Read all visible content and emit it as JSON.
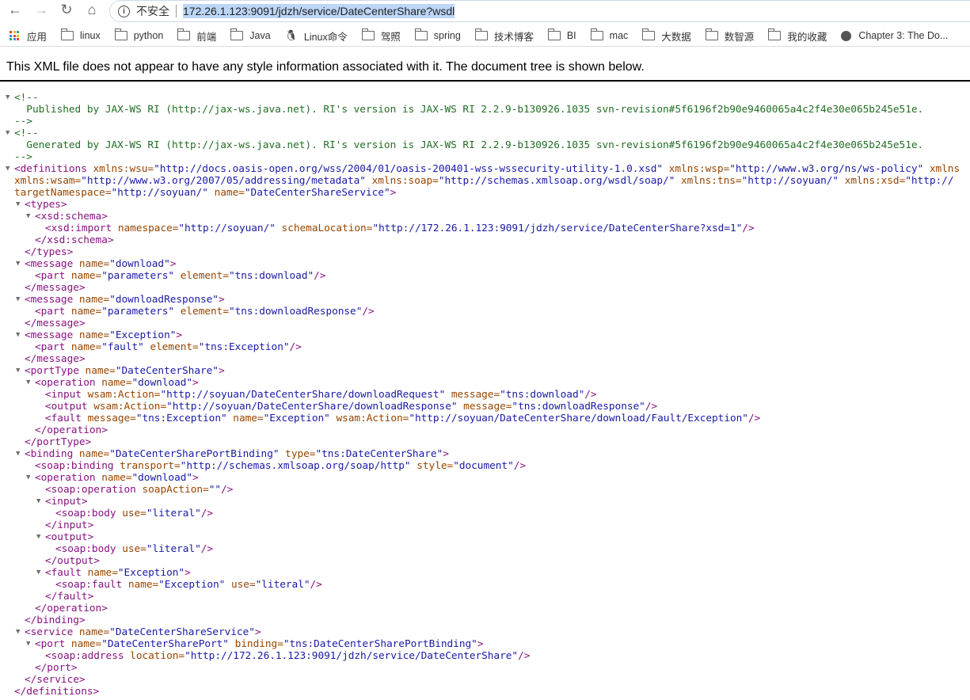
{
  "browser": {
    "insecure_label": "不安全",
    "url": "172.26.1.123:9091/jdzh/service/DateCenterShare?wsdl",
    "bookmarks": [
      {
        "label": "应用",
        "icon": "apps-icon"
      },
      {
        "label": "linux",
        "icon": "folder-icon"
      },
      {
        "label": "python",
        "icon": "folder-icon"
      },
      {
        "label": "前端",
        "icon": "folder-icon"
      },
      {
        "label": "Java",
        "icon": "folder-icon"
      },
      {
        "label": "Linux命令",
        "icon": "tux-icon"
      },
      {
        "label": "驾照",
        "icon": "folder-icon"
      },
      {
        "label": "spring",
        "icon": "folder-icon"
      },
      {
        "label": "技术博客",
        "icon": "folder-icon"
      },
      {
        "label": "BI",
        "icon": "folder-icon"
      },
      {
        "label": "mac",
        "icon": "folder-icon"
      },
      {
        "label": "大数据",
        "icon": "folder-icon"
      },
      {
        "label": "数智源",
        "icon": "folder-icon"
      },
      {
        "label": "我的收藏",
        "icon": "folder-icon"
      },
      {
        "label": "Chapter 3: The Do...",
        "icon": "globe-icon"
      }
    ]
  },
  "notice": "This XML file does not appear to have any style information associated with it. The document tree is shown below.",
  "colors": {
    "tag": "#881280",
    "attr": "#994500",
    "value": "#1a1aa6",
    "comment": "#236e25"
  },
  "lines": [
    {
      "d": 0,
      "t": true,
      "s": [
        [
          "c",
          "<!--"
        ]
      ]
    },
    {
      "d": 0,
      "s": [
        [
          "c",
          "  Published by JAX-WS RI (http://jax-ws.java.net). RI's version is JAX-WS RI 2.2.9-b130926.1035 svn-revision#5f6196f2b90e9460065a4c2f4e30e065b245e51e."
        ]
      ]
    },
    {
      "d": 0,
      "s": [
        [
          "c",
          "-->"
        ]
      ]
    },
    {
      "d": 0,
      "t": true,
      "s": [
        [
          "c",
          "<!--"
        ]
      ]
    },
    {
      "d": 0,
      "s": [
        [
          "c",
          "  Generated by JAX-WS RI (http://jax-ws.java.net). RI's version is JAX-WS RI 2.2.9-b130926.1035 svn-revision#5f6196f2b90e9460065a4c2f4e30e065b245e51e."
        ]
      ]
    },
    {
      "d": 0,
      "s": [
        [
          "c",
          "-->"
        ]
      ]
    },
    {
      "d": 0,
      "t": true,
      "s": [
        [
          "p",
          "<definitions"
        ],
        [
          "a",
          " xmlns:wsu="
        ],
        [
          "v",
          "\"http://docs.oasis-open.org/wss/2004/01/oasis-200401-wss-wssecurity-utility-1.0.xsd\""
        ],
        [
          "a",
          " xmlns:wsp="
        ],
        [
          "v",
          "\"http://www.w3.org/ns/ws-policy\""
        ],
        [
          "a",
          " xmlns"
        ]
      ]
    },
    {
      "d": 0,
      "s": [
        [
          "a",
          "xmlns:wsam="
        ],
        [
          "v",
          "\"http://www.w3.org/2007/05/addressing/metadata\""
        ],
        [
          "a",
          " xmlns:soap="
        ],
        [
          "v",
          "\"http://schemas.xmlsoap.org/wsdl/soap/\""
        ],
        [
          "a",
          " xmlns:tns="
        ],
        [
          "v",
          "\"http://soyuan/\""
        ],
        [
          "a",
          " xmlns:xsd="
        ],
        [
          "v",
          "\"http://"
        ]
      ]
    },
    {
      "d": 0,
      "s": [
        [
          "a",
          "targetNamespace="
        ],
        [
          "v",
          "\"http://soyuan/\""
        ],
        [
          "a",
          " name="
        ],
        [
          "v",
          "\"DateCenterShareService\""
        ],
        [
          "p",
          ">"
        ]
      ]
    },
    {
      "d": 1,
      "t": true,
      "s": [
        [
          "p",
          "<types>"
        ]
      ]
    },
    {
      "d": 2,
      "t": true,
      "s": [
        [
          "p",
          "<xsd:schema>"
        ]
      ]
    },
    {
      "d": 3,
      "s": [
        [
          "p",
          "<xsd:import"
        ],
        [
          "a",
          " namespace="
        ],
        [
          "v",
          "\"http://soyuan/\""
        ],
        [
          "a",
          " schemaLocation="
        ],
        [
          "v",
          "\"http://172.26.1.123:9091/jdzh/service/DateCenterShare?xsd=1\""
        ],
        [
          "p",
          "/>"
        ]
      ]
    },
    {
      "d": 2,
      "s": [
        [
          "p",
          "</xsd:schema>"
        ]
      ]
    },
    {
      "d": 1,
      "s": [
        [
          "p",
          "</types>"
        ]
      ]
    },
    {
      "d": 1,
      "t": true,
      "s": [
        [
          "p",
          "<message"
        ],
        [
          "a",
          " name="
        ],
        [
          "v",
          "\"download\""
        ],
        [
          "p",
          ">"
        ]
      ]
    },
    {
      "d": 2,
      "s": [
        [
          "p",
          "<part"
        ],
        [
          "a",
          " name="
        ],
        [
          "v",
          "\"parameters\""
        ],
        [
          "a",
          " element="
        ],
        [
          "v",
          "\"tns:download\""
        ],
        [
          "p",
          "/>"
        ]
      ]
    },
    {
      "d": 1,
      "s": [
        [
          "p",
          "</message>"
        ]
      ]
    },
    {
      "d": 1,
      "t": true,
      "s": [
        [
          "p",
          "<message"
        ],
        [
          "a",
          " name="
        ],
        [
          "v",
          "\"downloadResponse\""
        ],
        [
          "p",
          ">"
        ]
      ]
    },
    {
      "d": 2,
      "s": [
        [
          "p",
          "<part"
        ],
        [
          "a",
          " name="
        ],
        [
          "v",
          "\"parameters\""
        ],
        [
          "a",
          " element="
        ],
        [
          "v",
          "\"tns:downloadResponse\""
        ],
        [
          "p",
          "/>"
        ]
      ]
    },
    {
      "d": 1,
      "s": [
        [
          "p",
          "</message>"
        ]
      ]
    },
    {
      "d": 1,
      "t": true,
      "s": [
        [
          "p",
          "<message"
        ],
        [
          "a",
          " name="
        ],
        [
          "v",
          "\"Exception\""
        ],
        [
          "p",
          ">"
        ]
      ]
    },
    {
      "d": 2,
      "s": [
        [
          "p",
          "<part"
        ],
        [
          "a",
          " name="
        ],
        [
          "v",
          "\"fault\""
        ],
        [
          "a",
          " element="
        ],
        [
          "v",
          "\"tns:Exception\""
        ],
        [
          "p",
          "/>"
        ]
      ]
    },
    {
      "d": 1,
      "s": [
        [
          "p",
          "</message>"
        ]
      ]
    },
    {
      "d": 1,
      "t": true,
      "s": [
        [
          "p",
          "<portType"
        ],
        [
          "a",
          " name="
        ],
        [
          "v",
          "\"DateCenterShare\""
        ],
        [
          "p",
          ">"
        ]
      ]
    },
    {
      "d": 2,
      "t": true,
      "s": [
        [
          "p",
          "<operation"
        ],
        [
          "a",
          " name="
        ],
        [
          "v",
          "\"download\""
        ],
        [
          "p",
          ">"
        ]
      ]
    },
    {
      "d": 3,
      "s": [
        [
          "p",
          "<input"
        ],
        [
          "a",
          " wsam:Action="
        ],
        [
          "v",
          "\"http://soyuan/DateCenterShare/downloadRequest\""
        ],
        [
          "a",
          " message="
        ],
        [
          "v",
          "\"tns:download\""
        ],
        [
          "p",
          "/>"
        ]
      ]
    },
    {
      "d": 3,
      "s": [
        [
          "p",
          "<output"
        ],
        [
          "a",
          " wsam:Action="
        ],
        [
          "v",
          "\"http://soyuan/DateCenterShare/downloadResponse\""
        ],
        [
          "a",
          " message="
        ],
        [
          "v",
          "\"tns:downloadResponse\""
        ],
        [
          "p",
          "/>"
        ]
      ]
    },
    {
      "d": 3,
      "s": [
        [
          "p",
          "<fault"
        ],
        [
          "a",
          " message="
        ],
        [
          "v",
          "\"tns:Exception\""
        ],
        [
          "a",
          " name="
        ],
        [
          "v",
          "\"Exception\""
        ],
        [
          "a",
          " wsam:Action="
        ],
        [
          "v",
          "\"http://soyuan/DateCenterShare/download/Fault/Exception\""
        ],
        [
          "p",
          "/>"
        ]
      ]
    },
    {
      "d": 2,
      "s": [
        [
          "p",
          "</operation>"
        ]
      ]
    },
    {
      "d": 1,
      "s": [
        [
          "p",
          "</portType>"
        ]
      ]
    },
    {
      "d": 1,
      "t": true,
      "s": [
        [
          "p",
          "<binding"
        ],
        [
          "a",
          " name="
        ],
        [
          "v",
          "\"DateCenterSharePortBinding\""
        ],
        [
          "a",
          " type="
        ],
        [
          "v",
          "\"tns:DateCenterShare\""
        ],
        [
          "p",
          ">"
        ]
      ]
    },
    {
      "d": 2,
      "s": [
        [
          "p",
          "<soap:binding"
        ],
        [
          "a",
          " transport="
        ],
        [
          "v",
          "\"http://schemas.xmlsoap.org/soap/http\""
        ],
        [
          "a",
          " style="
        ],
        [
          "v",
          "\"document\""
        ],
        [
          "p",
          "/>"
        ]
      ]
    },
    {
      "d": 2,
      "t": true,
      "s": [
        [
          "p",
          "<operation"
        ],
        [
          "a",
          " name="
        ],
        [
          "v",
          "\"download\""
        ],
        [
          "p",
          ">"
        ]
      ]
    },
    {
      "d": 3,
      "s": [
        [
          "p",
          "<soap:operation"
        ],
        [
          "a",
          " soapAction="
        ],
        [
          "v",
          "\"\""
        ],
        [
          "p",
          "/>"
        ]
      ]
    },
    {
      "d": 3,
      "t": true,
      "s": [
        [
          "p",
          "<input>"
        ]
      ]
    },
    {
      "d": 4,
      "s": [
        [
          "p",
          "<soap:body"
        ],
        [
          "a",
          " use="
        ],
        [
          "v",
          "\"literal\""
        ],
        [
          "p",
          "/>"
        ]
      ]
    },
    {
      "d": 3,
      "s": [
        [
          "p",
          "</input>"
        ]
      ]
    },
    {
      "d": 3,
      "t": true,
      "s": [
        [
          "p",
          "<output>"
        ]
      ]
    },
    {
      "d": 4,
      "s": [
        [
          "p",
          "<soap:body"
        ],
        [
          "a",
          " use="
        ],
        [
          "v",
          "\"literal\""
        ],
        [
          "p",
          "/>"
        ]
      ]
    },
    {
      "d": 3,
      "s": [
        [
          "p",
          "</output>"
        ]
      ]
    },
    {
      "d": 3,
      "t": true,
      "s": [
        [
          "p",
          "<fault"
        ],
        [
          "a",
          " name="
        ],
        [
          "v",
          "\"Exception\""
        ],
        [
          "p",
          ">"
        ]
      ]
    },
    {
      "d": 4,
      "s": [
        [
          "p",
          "<soap:fault"
        ],
        [
          "a",
          " name="
        ],
        [
          "v",
          "\"Exception\""
        ],
        [
          "a",
          " use="
        ],
        [
          "v",
          "\"literal\""
        ],
        [
          "p",
          "/>"
        ]
      ]
    },
    {
      "d": 3,
      "s": [
        [
          "p",
          "</fault>"
        ]
      ]
    },
    {
      "d": 2,
      "s": [
        [
          "p",
          "</operation>"
        ]
      ]
    },
    {
      "d": 1,
      "s": [
        [
          "p",
          "</binding>"
        ]
      ]
    },
    {
      "d": 1,
      "t": true,
      "s": [
        [
          "p",
          "<service"
        ],
        [
          "a",
          " name="
        ],
        [
          "v",
          "\"DateCenterShareService\""
        ],
        [
          "p",
          ">"
        ]
      ]
    },
    {
      "d": 2,
      "t": true,
      "s": [
        [
          "p",
          "<port"
        ],
        [
          "a",
          " name="
        ],
        [
          "v",
          "\"DateCenterSharePort\""
        ],
        [
          "a",
          " binding="
        ],
        [
          "v",
          "\"tns:DateCenterSharePortBinding\""
        ],
        [
          "p",
          ">"
        ]
      ]
    },
    {
      "d": 3,
      "s": [
        [
          "p",
          "<soap:address"
        ],
        [
          "a",
          " location="
        ],
        [
          "v",
          "\"http://172.26.1.123:9091/jdzh/service/DateCenterShare\""
        ],
        [
          "p",
          "/>"
        ]
      ]
    },
    {
      "d": 2,
      "s": [
        [
          "p",
          "</port>"
        ]
      ]
    },
    {
      "d": 1,
      "s": [
        [
          "p",
          "</service>"
        ]
      ]
    },
    {
      "d": 0,
      "s": [
        [
          "p",
          "</definitions>"
        ]
      ]
    }
  ]
}
